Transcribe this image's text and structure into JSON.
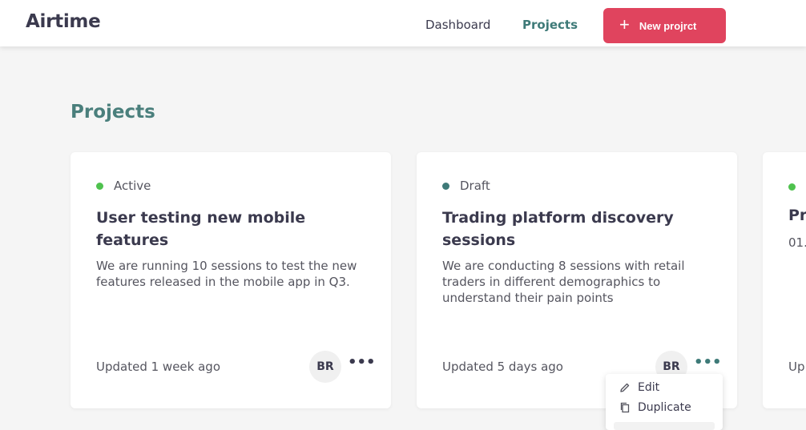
{
  "header": {
    "logo": "Airtime",
    "nav": {
      "dashboard": "Dashboard",
      "projects": "Projects"
    },
    "new_button_label": "New projrct"
  },
  "page": {
    "title": "Projects"
  },
  "cards": [
    {
      "status": "Active",
      "status_color": "#4fc24e",
      "title": "User testing new mobile features",
      "description": "We are running 10 sessions to test the new features released in the mobile app in Q3.",
      "updated": "Updated 1 week ago",
      "avatar": "BR"
    },
    {
      "status": "Draft",
      "status_color": "#3e7a78",
      "title": "Trading platform discovery sessions",
      "description": "We are conducting 8 sessions with retail traders in different demographics to understand their pain points",
      "updated": "Updated 5 days ago",
      "avatar": "BR"
    },
    {
      "status_color": "#4fc24e",
      "title_partial": "Pr",
      "sub_partial": "01.0",
      "updated_partial": "Up"
    }
  ],
  "menu": {
    "edit": "Edit",
    "duplicate": "Duplicate"
  },
  "colors": {
    "accent": "#3e7a78",
    "brand_button": "#e0445e"
  }
}
